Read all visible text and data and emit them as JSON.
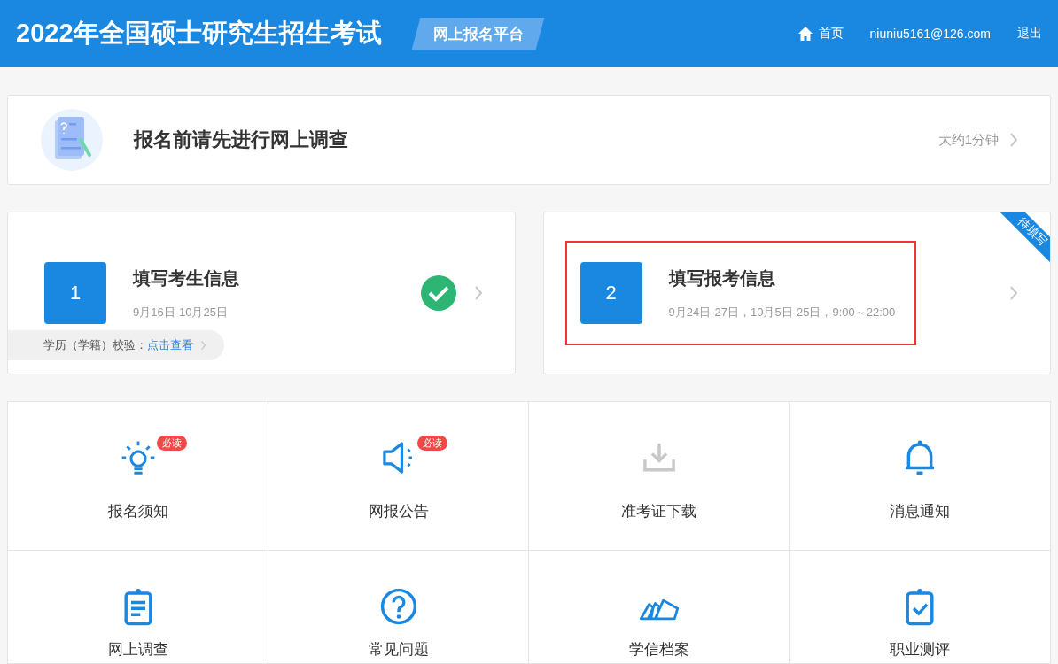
{
  "header": {
    "title": "2022年全国硕士研究生招生考试",
    "platform_tag": "网上报名平台",
    "nav": [
      {
        "kind": "home",
        "label": "首页"
      },
      {
        "kind": "text",
        "label": "niuniu5161@126.com"
      },
      {
        "kind": "text",
        "label": "退出"
      }
    ]
  },
  "survey_banner": {
    "title": "报名前请先进行网上调查",
    "hint": "大约1分钟"
  },
  "steps": [
    {
      "number": "1",
      "title": "填写考生信息",
      "dates": "9月16日-10月25日",
      "completed": true,
      "highlighted": false,
      "check": {
        "label": "学历（学籍）校验：",
        "link": "点击查看"
      }
    },
    {
      "number": "2",
      "title": "填写报考信息",
      "dates": "9月24日-27日，10月5日-25日，9:00～22:00",
      "completed": false,
      "highlighted": true,
      "ribbon": "待填写"
    }
  ],
  "tiles": [
    {
      "kind": "bulb",
      "label": "报名须知",
      "badge": "必读",
      "disabled": false
    },
    {
      "kind": "speaker",
      "label": "网报公告",
      "badge": "必读",
      "disabled": false
    },
    {
      "kind": "download",
      "label": "准考证下载",
      "disabled": true
    },
    {
      "kind": "bell",
      "label": "消息通知",
      "disabled": false
    },
    {
      "kind": "clipboard",
      "label": "网上调查",
      "disabled": false
    },
    {
      "kind": "question",
      "label": "常见问题",
      "disabled": false
    },
    {
      "kind": "files",
      "label": "学信档案",
      "disabled": false
    },
    {
      "kind": "check-board",
      "label": "职业测评",
      "disabled": false
    }
  ]
}
